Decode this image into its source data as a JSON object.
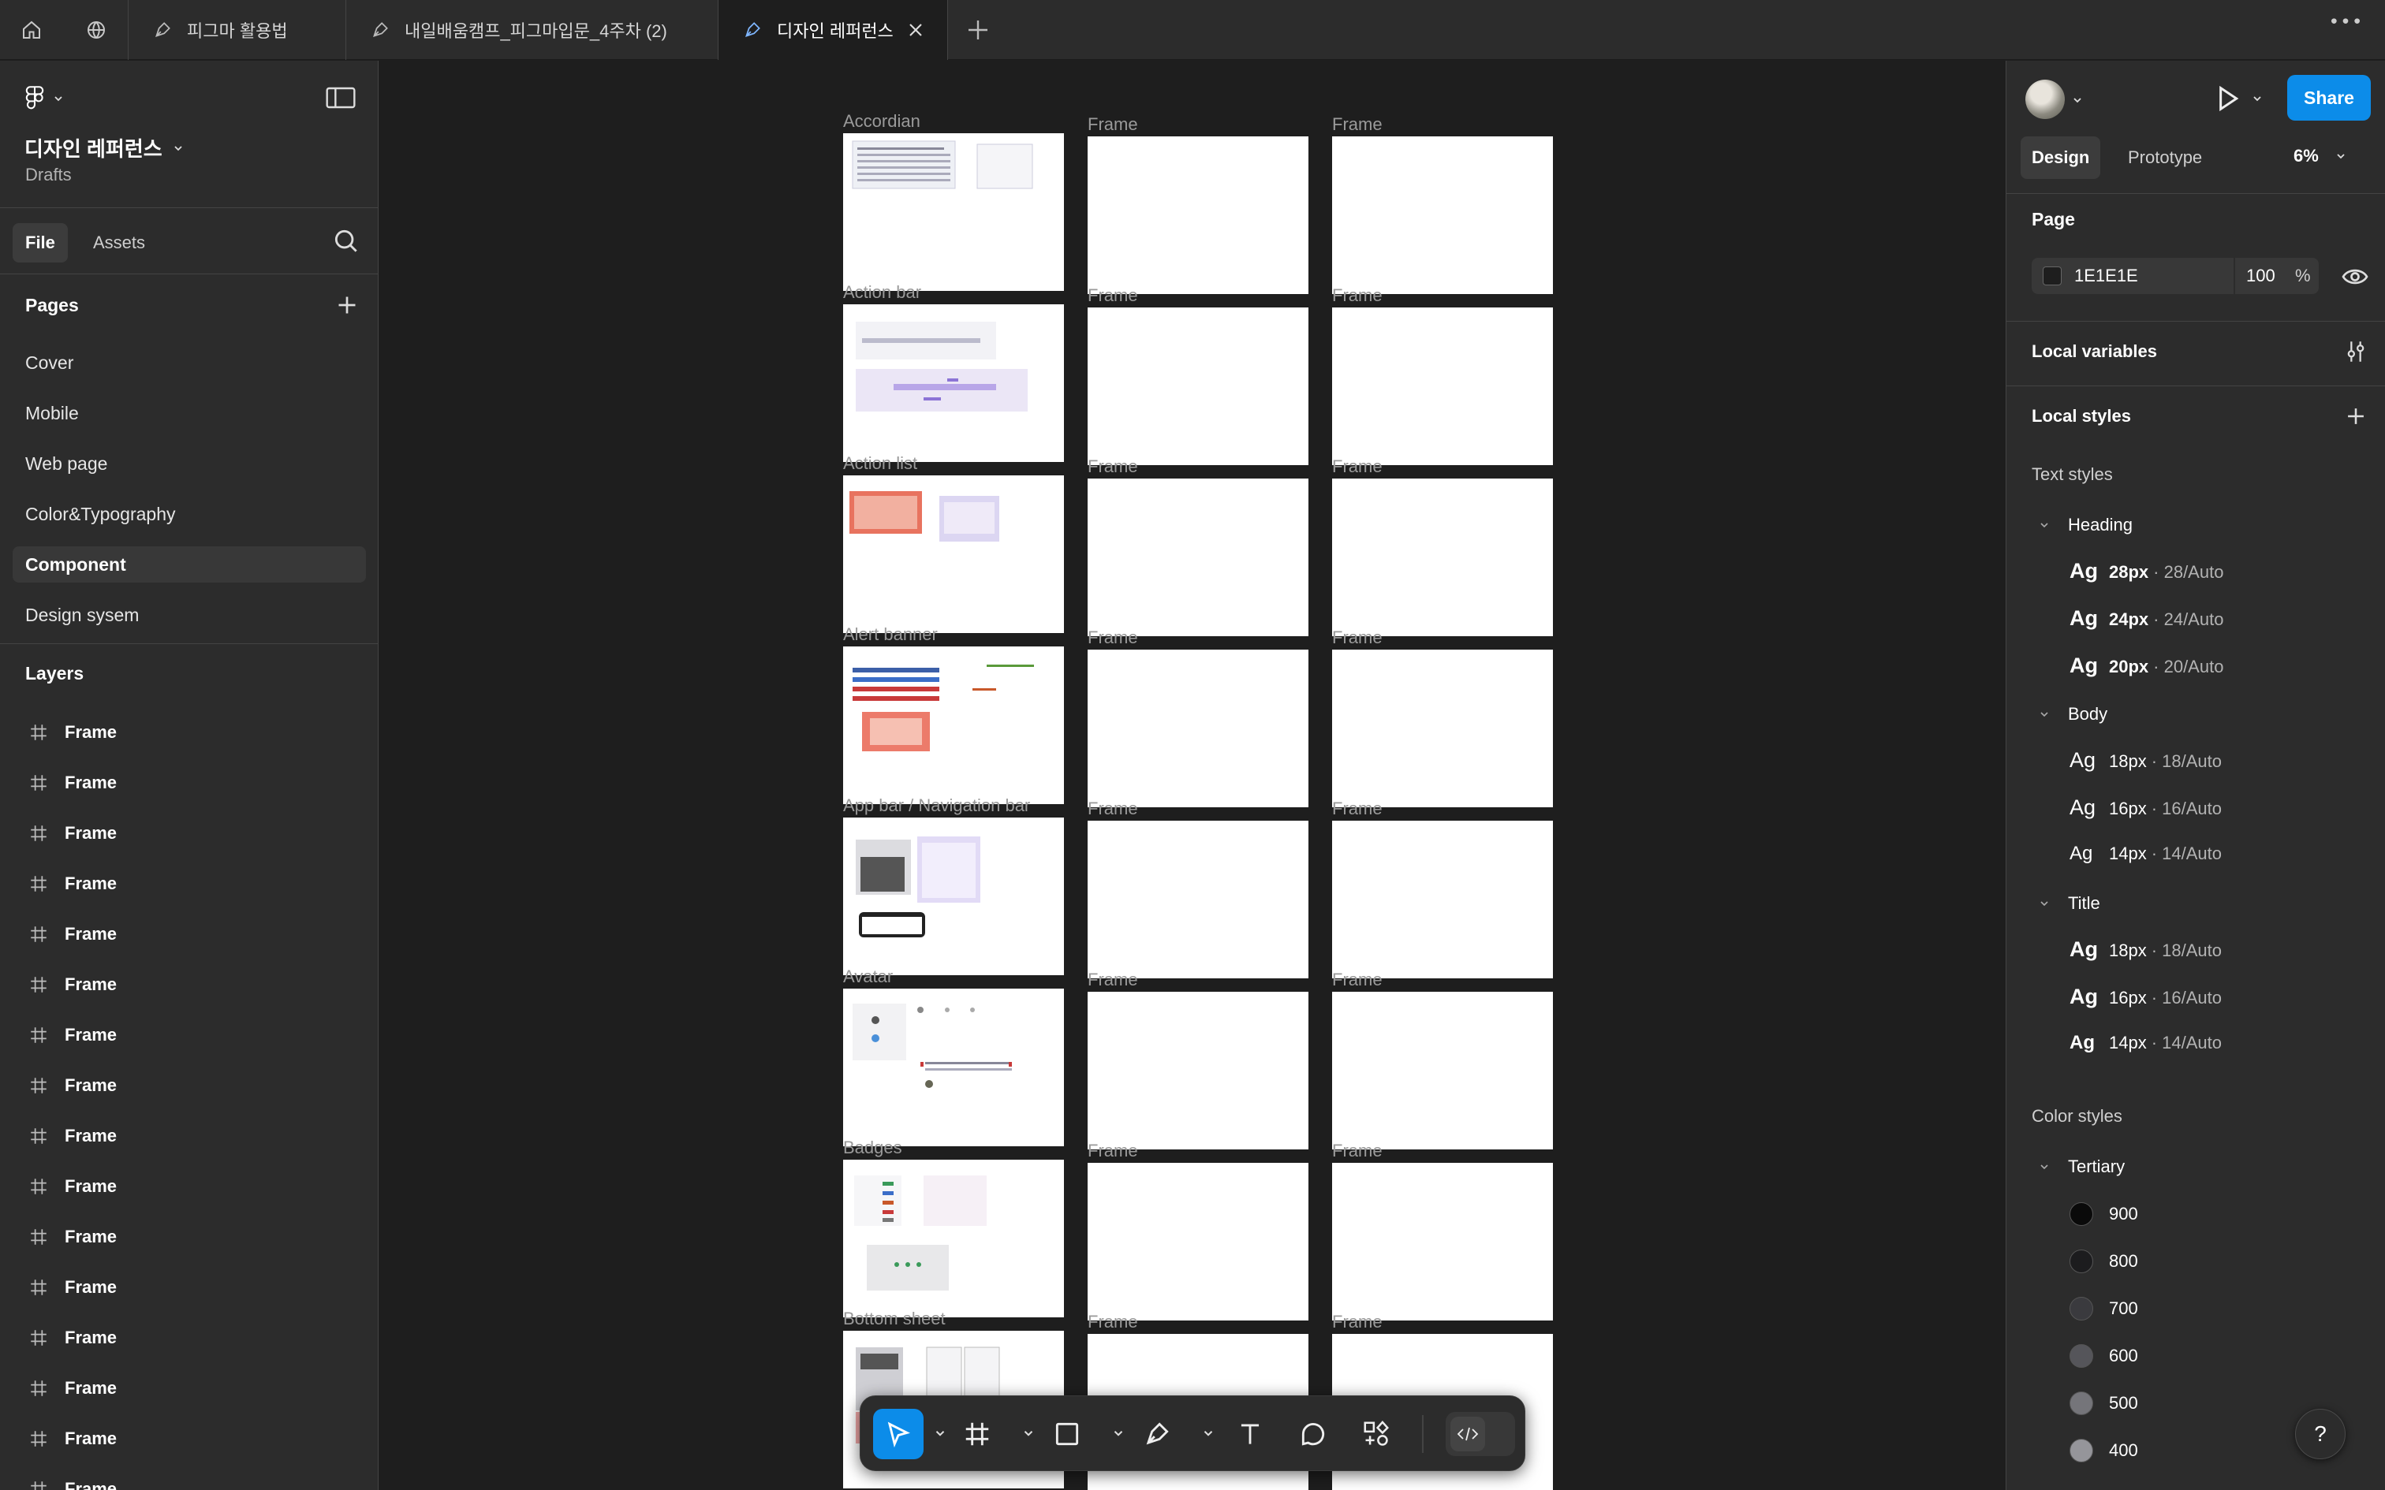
{
  "tabs": [
    {
      "label": "피그마 활용법"
    },
    {
      "label": "내일배움캠프_피그마입문_4주차 (2)"
    },
    {
      "label": "디자인 레퍼런스",
      "active": true
    }
  ],
  "left": {
    "file_name": "디자인 레퍼런스",
    "location": "Drafts",
    "tab_file": "File",
    "tab_assets": "Assets",
    "pages_title": "Pages",
    "pages": [
      "Cover",
      "Mobile",
      "Web page",
      "Color&Typography",
      "Component",
      "Design sysem"
    ],
    "active_page": "Component",
    "layers_title": "Layers",
    "layers": [
      "Frame",
      "Frame",
      "Frame",
      "Frame",
      "Frame",
      "Frame",
      "Frame",
      "Frame",
      "Frame",
      "Frame",
      "Frame",
      "Frame",
      "Frame",
      "Frame",
      "Frame",
      "Frame"
    ]
  },
  "canvas": {
    "col1_labels": [
      "Accordian",
      "Action bar",
      "Action list",
      "Alert banner",
      "App bar / Navigation bar",
      "Avatar",
      "Badges",
      "Bottom sheet"
    ],
    "col_frame_label": "Frame"
  },
  "toolbar": {
    "tools": [
      "move-tool",
      "frame-tool",
      "shape-tool",
      "pen-tool",
      "text-tool",
      "comment-tool",
      "resources-tool",
      "dev-mode-toggle"
    ]
  },
  "right": {
    "share_label": "Share",
    "tab_design": "Design",
    "tab_prototype": "Prototype",
    "zoom": "6%",
    "page_title": "Page",
    "page_color": "1E1E1E",
    "page_opacity": "100",
    "pct": "%",
    "local_variables": "Local variables",
    "local_styles": "Local styles",
    "text_styles": "Text styles",
    "groups": {
      "heading": "Heading",
      "body": "Body",
      "title": "Title"
    },
    "heading_styles": [
      {
        "ag": "Ag",
        "size": "28px",
        "meta": "· 28/Auto"
      },
      {
        "ag": "Ag",
        "size": "24px",
        "meta": "· 24/Auto"
      },
      {
        "ag": "Ag",
        "size": "20px",
        "meta": "· 20/Auto"
      }
    ],
    "body_styles": [
      {
        "ag": "Ag",
        "size": "18px",
        "meta": "· 18/Auto"
      },
      {
        "ag": "Ag",
        "size": "16px",
        "meta": "· 16/Auto"
      },
      {
        "ag": "Ag",
        "size": "14px",
        "meta": "· 14/Auto"
      }
    ],
    "title_styles": [
      {
        "ag": "Ag",
        "size": "18px",
        "meta": "· 18/Auto"
      },
      {
        "ag": "Ag",
        "size": "16px",
        "meta": "· 16/Auto"
      },
      {
        "ag": "Ag",
        "size": "14px",
        "meta": "· 14/Auto"
      }
    ],
    "color_styles": "Color styles",
    "tertiary": "Tertiary",
    "colors": [
      {
        "name": "900",
        "hex": "#0a0a0a"
      },
      {
        "name": "800",
        "hex": "#1c1c1e"
      },
      {
        "name": "700",
        "hex": "#3a3a3e"
      },
      {
        "name": "600",
        "hex": "#55555a"
      },
      {
        "name": "500",
        "hex": "#75757a"
      },
      {
        "name": "400",
        "hex": "#95959a"
      }
    ],
    "help": "?"
  },
  "colors": {
    "accent": "#0c8ce9",
    "panel": "#2c2c2c",
    "canvas": "#1e1e1e"
  }
}
